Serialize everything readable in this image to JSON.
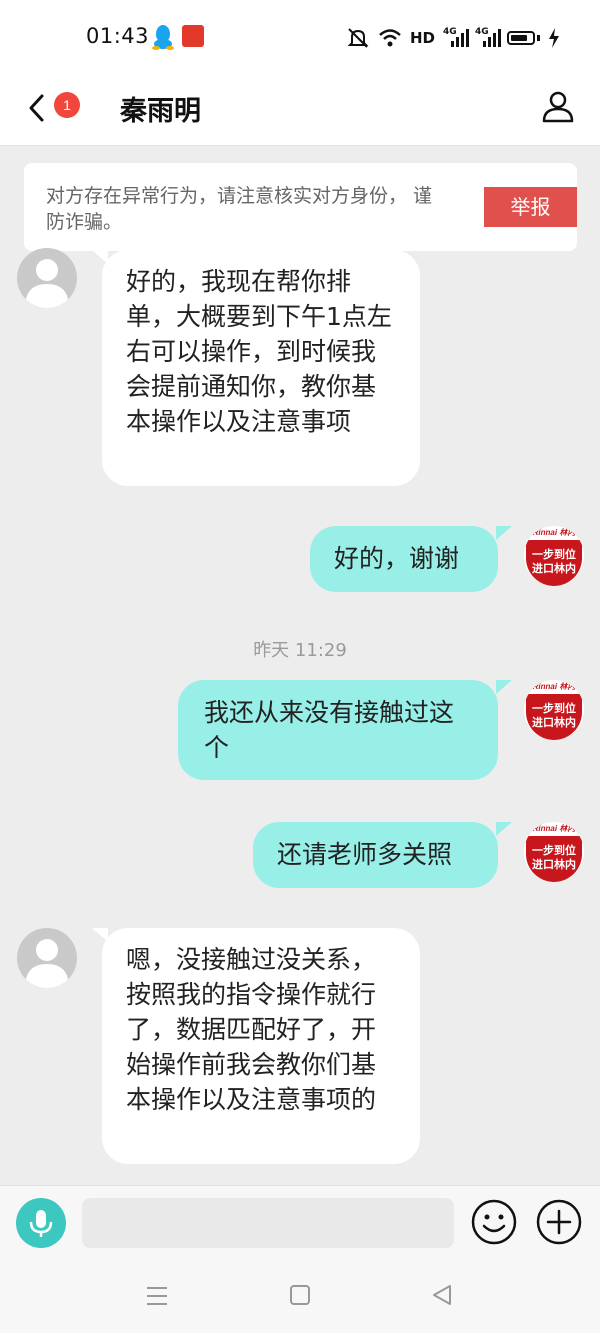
{
  "status_bar": {
    "time": "01:43",
    "network_label": "HD",
    "signal_labels": [
      "4G",
      "4G"
    ]
  },
  "header": {
    "back_icon": "chevron-left-icon",
    "unread_badge": "1",
    "title": "秦雨明",
    "profile_icon": "person-icon"
  },
  "warning": {
    "text": "对方存在异常行为，请注意核实对方身份， 谨防诈骗。",
    "report_button": "举报"
  },
  "messages": [
    {
      "side": "left",
      "text": "好的，我现在帮你排单，大概要到下午1点左右可以操作，到时候我会提前通知你，教你基本操作以及注意事项"
    },
    {
      "side": "right",
      "text": "好的，谢谢"
    },
    {
      "side": "right",
      "text": "我还从来没有接触过这个"
    },
    {
      "side": "right",
      "text": "还请老师多关照"
    },
    {
      "side": "left",
      "text": "嗯，没接触过没关系，按照我的指令操作就行了，数据匹配好了，开始操作前我会教你们基本操作以及注意事项的"
    }
  ],
  "timestamp": "昨天 11:29",
  "brand_avatar": {
    "brand": "Rinnai 林内",
    "line1": "一步到位",
    "line2": "进口林内",
    "color": "#c8161d"
  },
  "input_bar": {
    "placeholder": "",
    "voice_icon": "microphone-icon",
    "emoji_icon": "smiley-icon",
    "plus_icon": "plus-icon"
  },
  "nav_bar": {
    "menu_icon": "menu-icon",
    "home_icon": "square-home-icon",
    "back_icon": "triangle-back-icon"
  },
  "colors": {
    "accent": "#3cc7c0",
    "bubble_self": "#98efe8",
    "report": "#e0514d",
    "badge": "#f0463c"
  }
}
